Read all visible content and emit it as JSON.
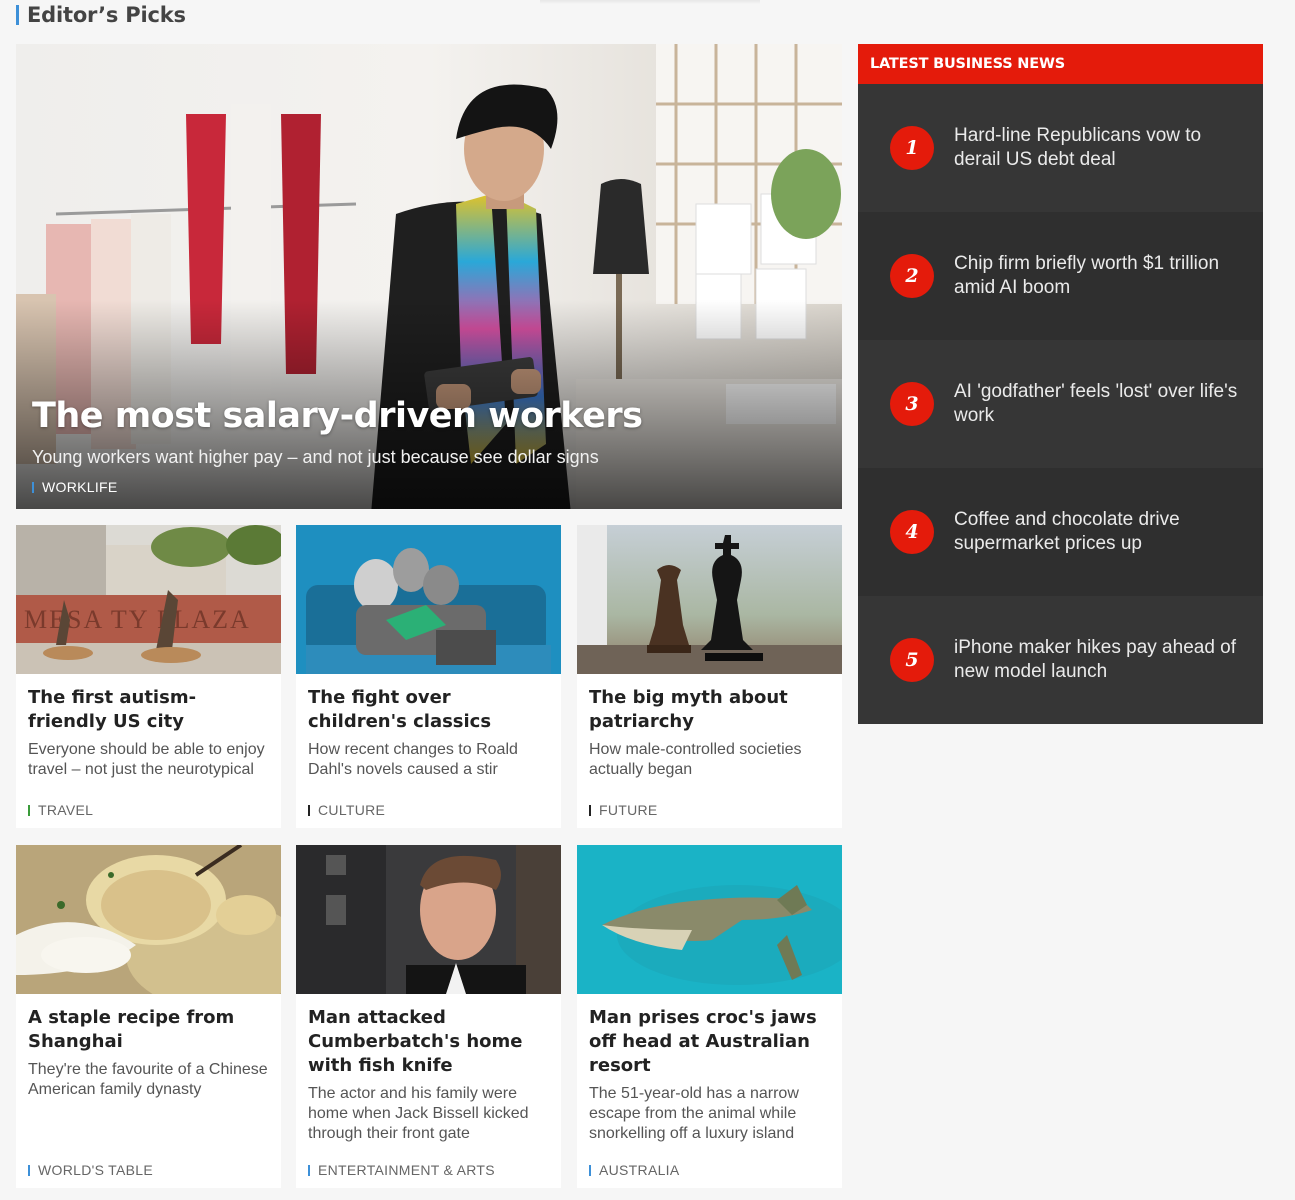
{
  "section": {
    "title": "Editor’s Picks"
  },
  "hero": {
    "title": "The most salary-driven workers",
    "subtitle": "Young workers want higher pay – and not just because see dollar signs",
    "tag": "WORKLIFE",
    "tag_color": "#3d90d8"
  },
  "cards": [
    {
      "title": "The first autism-friendly US city",
      "desc": "Everyone should be able to enjoy travel – not just the neurotypical",
      "tag": "TRAVEL",
      "tag_color": "#3a9b3a"
    },
    {
      "title": "The fight over children's classics",
      "desc": "How recent changes to Roald Dahl's novels caused a stir",
      "tag": "CULTURE",
      "tag_color": "#222222"
    },
    {
      "title": "The big myth about patriarchy",
      "desc": "How male-controlled societies actually began",
      "tag": "FUTURE",
      "tag_color": "#222222"
    },
    {
      "title": "A staple recipe from Shanghai",
      "desc": "They're the favourite of a Chinese American family dynasty",
      "tag": "WORLD'S TABLE",
      "tag_color": "#3d90d8"
    },
    {
      "title": "Man attacked Cumberbatch's home with fish knife",
      "desc": "The actor and his family were home when Jack Bissell kicked through their front gate",
      "tag": "ENTERTAINMENT & ARTS",
      "tag_color": "#3d90d8"
    },
    {
      "title": "Man prises croc's jaws off head at Australian resort",
      "desc": "The 51-year-old has a narrow escape from the animal while snorkelling off a luxury island",
      "tag": "AUSTRALIA",
      "tag_color": "#3d90d8"
    }
  ],
  "image_text": {
    "mesa_sign": "MESA    TY   PLAZA"
  },
  "latest_news": {
    "title": "LATEST BUSINESS NEWS",
    "items": [
      {
        "num": "1",
        "text": "Hard-line Republicans vow to derail US debt deal"
      },
      {
        "num": "2",
        "text": "Chip firm briefly worth $1 trillion amid AI boom"
      },
      {
        "num": "3",
        "text": "AI 'godfather' feels 'lost' over life's work"
      },
      {
        "num": "4",
        "text": "Coffee and chocolate drive supermarket prices up"
      },
      {
        "num": "5",
        "text": "iPhone maker hikes pay ahead of new model launch"
      }
    ]
  }
}
